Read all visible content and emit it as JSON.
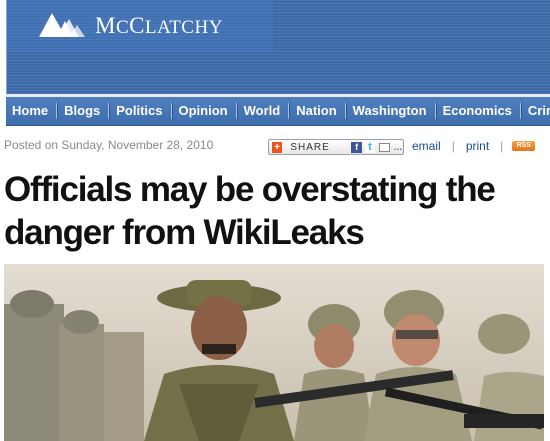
{
  "header": {
    "logo_text": "McClatchy",
    "brand_color": "#3e6aa6"
  },
  "nav": {
    "items": [
      "Home",
      "Blogs",
      "Politics",
      "Opinion",
      "World",
      "Nation",
      "Washington",
      "Economics",
      "Crim"
    ]
  },
  "article": {
    "posted": "Posted on Sunday, November 28, 2010",
    "headline": "Officials may be overstating the danger from WikiLeaks"
  },
  "tools": {
    "share_label": "SHARE",
    "email": "email",
    "print": "print",
    "separator": "|",
    "rss": "RSS"
  },
  "icons": [
    "mcclatchy-logo-icon",
    "share-plus-icon",
    "facebook-icon",
    "twitter-icon",
    "mail-icon",
    "more-icon",
    "rss-icon"
  ]
}
